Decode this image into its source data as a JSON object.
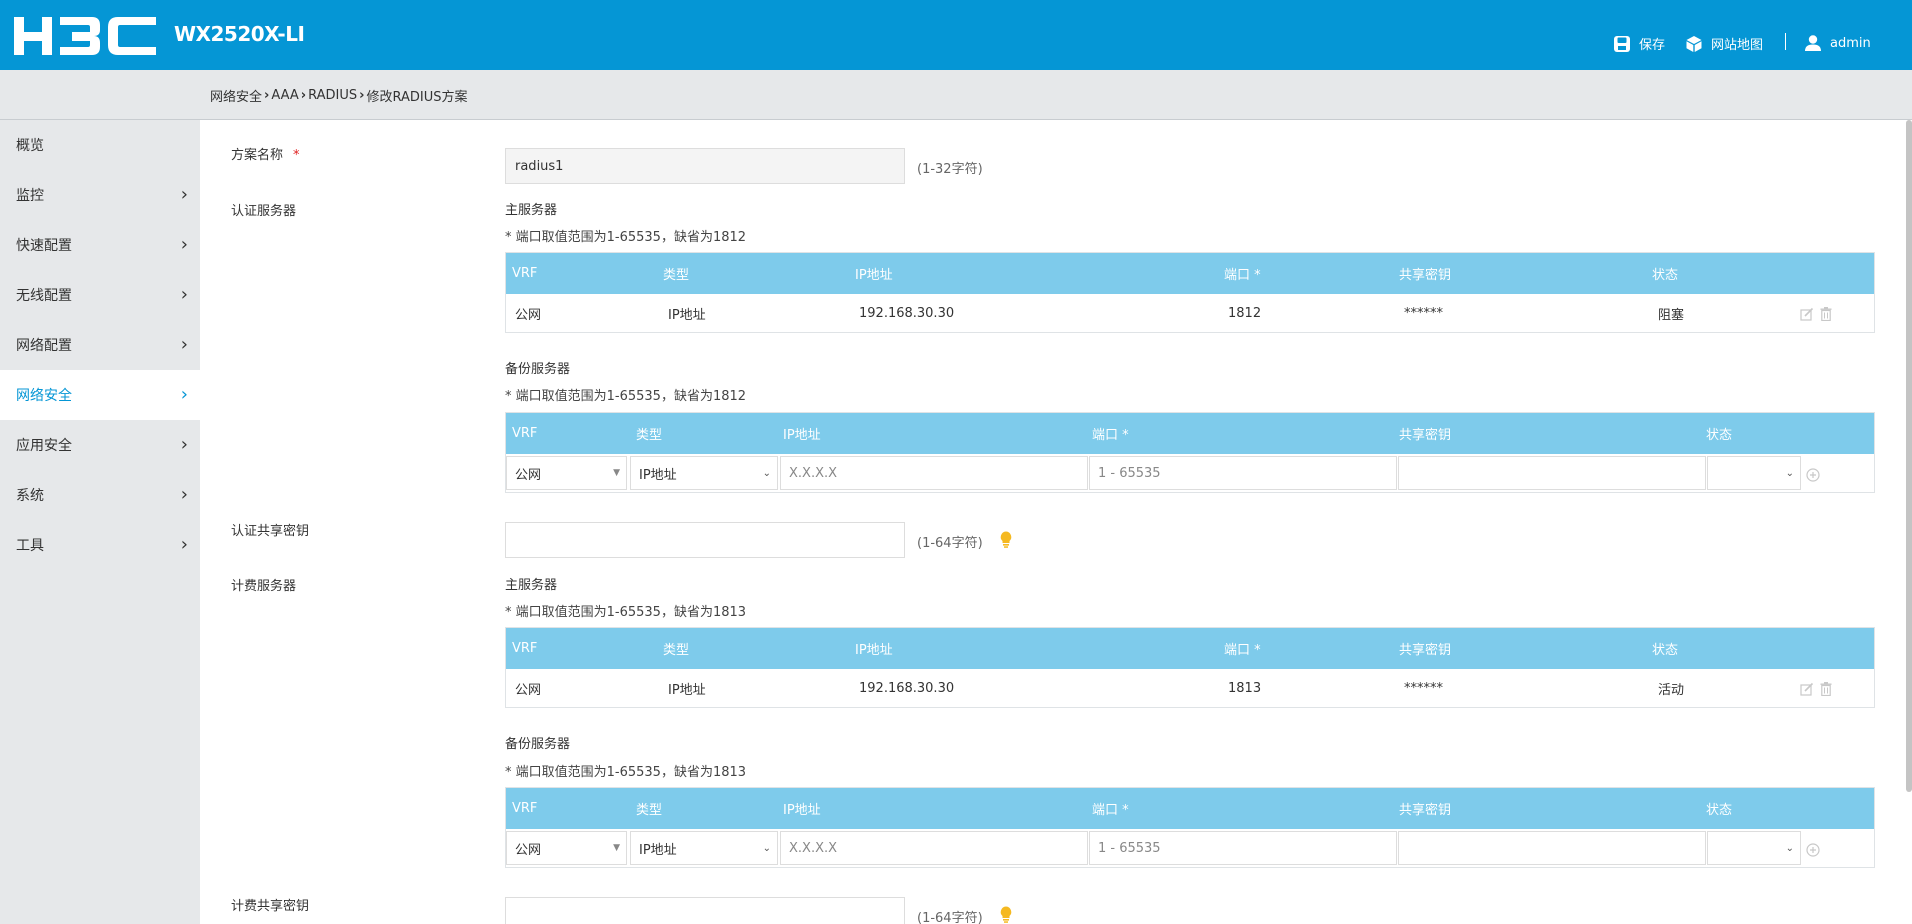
{
  "header": {
    "brand": "H3C",
    "model": "WX2520X-LI",
    "save_label": "保存",
    "sitemap_label": "网站地图",
    "user_label": "admin"
  },
  "breadcrumb": [
    "网络安全",
    "AAA",
    "RADIUS",
    "修改RADIUS方案"
  ],
  "sidebar": {
    "items": [
      {
        "label": "概览",
        "has_arrow": false
      },
      {
        "label": "监控",
        "has_arrow": true
      },
      {
        "label": "快速配置",
        "has_arrow": true
      },
      {
        "label": "无线配置",
        "has_arrow": true
      },
      {
        "label": "网络配置",
        "has_arrow": true
      },
      {
        "label": "网络安全",
        "has_arrow": true,
        "active": true
      },
      {
        "label": "应用安全",
        "has_arrow": true
      },
      {
        "label": "系统",
        "has_arrow": true
      },
      {
        "label": "工具",
        "has_arrow": true
      }
    ]
  },
  "form": {
    "scheme_name_label": "方案名称",
    "required_mark": "*",
    "scheme_name_value": "radius1",
    "scheme_name_hint": "(1-32字符)",
    "auth_server_label": "认证服务器",
    "auth_key_label": "认证共享密钥",
    "auth_key_hint": "(1-64字符)",
    "acct_server_label": "计费服务器",
    "acct_key_label": "计费共享密钥",
    "acct_key_hint": "(1-64字符)"
  },
  "auth": {
    "primary_title": "主服务器",
    "primary_note": "* 端口取值范围为1-65535，缺省为1812",
    "primary_headers": [
      "VRF",
      "类型",
      "IP地址",
      "端口 *",
      "共享密钥",
      "状态"
    ],
    "primary_row": {
      "vrf": "公网",
      "type": "IP地址",
      "ip": "192.168.30.30",
      "port": "1812",
      "key": "******",
      "status": "阻塞"
    },
    "backup_title": "备份服务器",
    "backup_note": "* 端口取值范围为1-65535，缺省为1812",
    "backup_headers": [
      "VRF",
      "类型",
      "IP地址",
      "端口 *",
      "共享密钥",
      "状态"
    ],
    "backup_row": {
      "vrf": "公网",
      "type": "IP地址",
      "ip_placeholder": "X.X.X.X",
      "port_placeholder": "1 - 65535"
    }
  },
  "acct": {
    "primary_title": "主服务器",
    "primary_note": "* 端口取值范围为1-65535，缺省为1813",
    "primary_headers": [
      "VRF",
      "类型",
      "IP地址",
      "端口 *",
      "共享密钥",
      "状态"
    ],
    "primary_row": {
      "vrf": "公网",
      "type": "IP地址",
      "ip": "192.168.30.30",
      "port": "1813",
      "key": "******",
      "status": "活动"
    },
    "backup_title": "备份服务器",
    "backup_note": "* 端口取值范围为1-65535，缺省为1813",
    "backup_headers": [
      "VRF",
      "类型",
      "IP地址",
      "端口 *",
      "共享密钥",
      "状态"
    ],
    "backup_row": {
      "vrf": "公网",
      "type": "IP地址",
      "ip_placeholder": "X.X.X.X",
      "port_placeholder": "1 - 65535"
    }
  },
  "colors": {
    "brand_blue": "#0596d5",
    "table_header": "#7ecbeb",
    "sidebar_bg": "#e6e8ea",
    "required_red": "#e02020",
    "bulb_yellow": "#f5b921"
  },
  "icons": [
    "save-icon",
    "sitemap-icon",
    "user-icon",
    "chevron-right-icon",
    "edit-icon",
    "delete-icon",
    "add-circle-icon",
    "lightbulb-icon"
  ]
}
